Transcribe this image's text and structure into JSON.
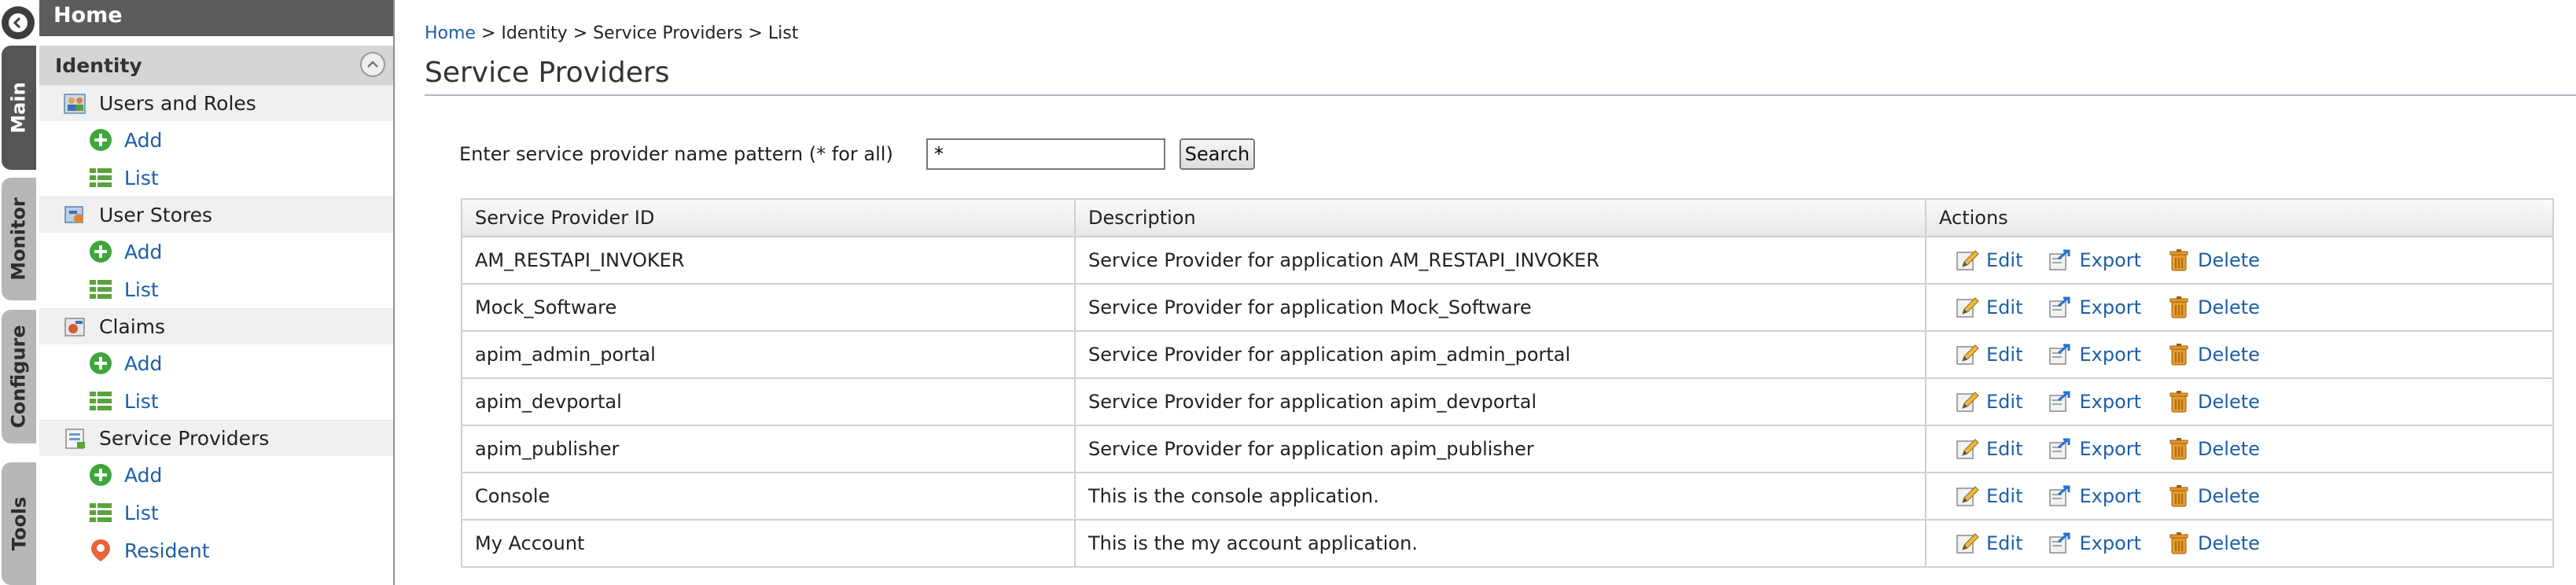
{
  "vertical_tabs": [
    {
      "label": "Main",
      "active": true
    },
    {
      "label": "Monitor",
      "active": false
    },
    {
      "label": "Configure",
      "active": false
    },
    {
      "label": "Tools",
      "active": false
    }
  ],
  "sidebar": {
    "home": "Home",
    "section": "Identity",
    "groups": [
      {
        "label": "Users and Roles",
        "icon": "users-roles-icon",
        "items": [
          {
            "label": "Add",
            "icon": "add-icon"
          },
          {
            "label": "List",
            "icon": "list-icon"
          }
        ]
      },
      {
        "label": "User Stores",
        "icon": "user-stores-icon",
        "items": [
          {
            "label": "Add",
            "icon": "add-icon"
          },
          {
            "label": "List",
            "icon": "list-icon"
          }
        ]
      },
      {
        "label": "Claims",
        "icon": "claims-icon",
        "items": [
          {
            "label": "Add",
            "icon": "add-icon"
          },
          {
            "label": "List",
            "icon": "list-icon"
          }
        ]
      },
      {
        "label": "Service Providers",
        "icon": "service-providers-icon",
        "items": [
          {
            "label": "Add",
            "icon": "add-icon"
          },
          {
            "label": "List",
            "icon": "list-icon"
          },
          {
            "label": "Resident",
            "icon": "resident-icon"
          }
        ]
      }
    ]
  },
  "breadcrumb": {
    "home": "Home",
    "rest": " > Identity > Service Providers > List"
  },
  "page_title": "Service Providers",
  "search": {
    "label": "Enter service provider name pattern (* for all)",
    "value": "*",
    "button": "Search"
  },
  "table": {
    "headers": {
      "id": "Service Provider ID",
      "description": "Description",
      "actions": "Actions"
    },
    "action_labels": {
      "edit": "Edit",
      "export": "Export",
      "delete": "Delete"
    },
    "rows": [
      {
        "id": "AM_RESTAPI_INVOKER",
        "description": "Service Provider for application AM_RESTAPI_INVOKER"
      },
      {
        "id": "Mock_Software",
        "description": "Service Provider for application Mock_Software"
      },
      {
        "id": "apim_admin_portal",
        "description": "Service Provider for application apim_admin_portal"
      },
      {
        "id": "apim_devportal",
        "description": "Service Provider for application apim_devportal"
      },
      {
        "id": "apim_publisher",
        "description": "Service Provider for application apim_publisher"
      },
      {
        "id": "Console",
        "description": "This is the console application."
      },
      {
        "id": "My Account",
        "description": "This is the my account application."
      }
    ]
  },
  "colors": {
    "link": "#1d5fa7",
    "sidebar_header": "#5c5c5c",
    "section_header": "#d5d5d5",
    "active_tab": "#555555",
    "inactive_tab": "#b7b7b7"
  }
}
